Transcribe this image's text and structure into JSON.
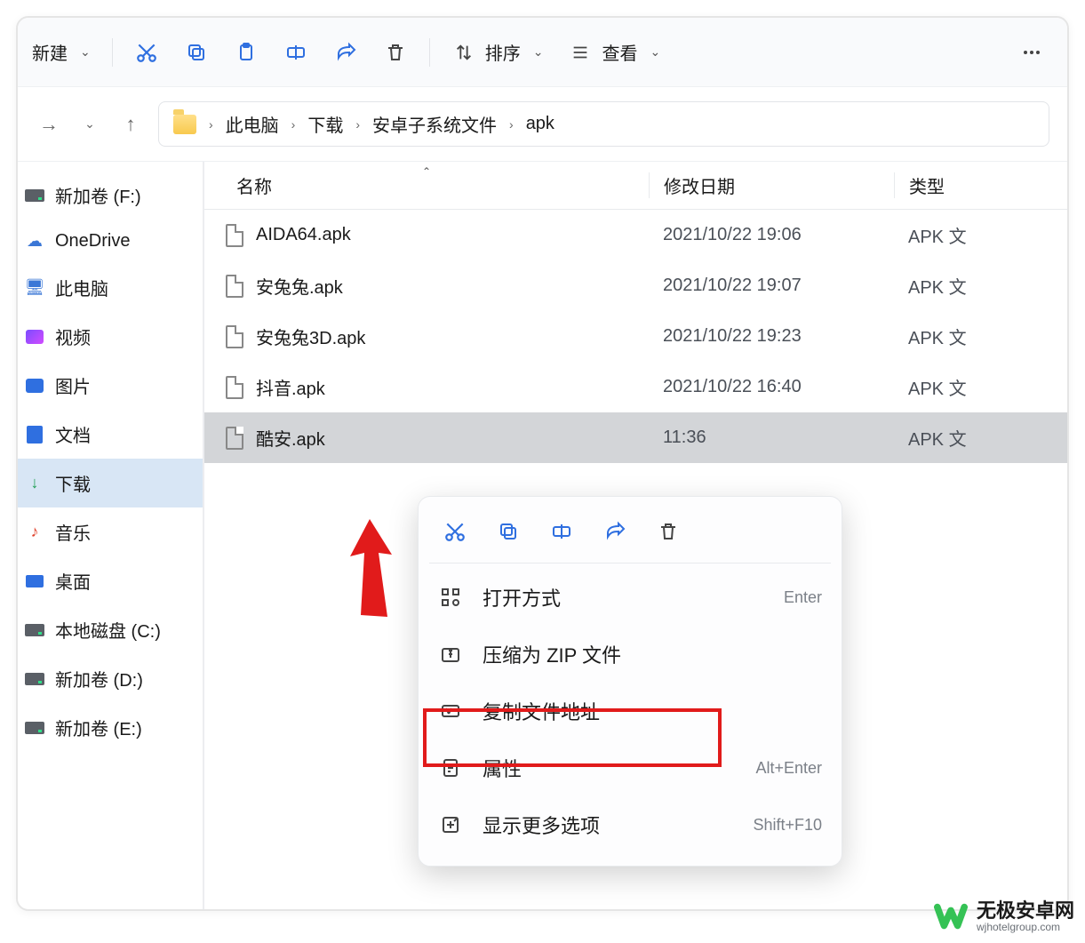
{
  "toolbar": {
    "new_label": "新建",
    "sort_label": "排序",
    "view_label": "查看"
  },
  "breadcrumb": [
    "此电脑",
    "下载",
    "安卓子系统文件",
    "apk"
  ],
  "sidebar": {
    "items": [
      {
        "label": "新加卷 (F:)",
        "icon": "drive"
      },
      {
        "label": "OneDrive",
        "icon": "cloud"
      },
      {
        "label": "此电脑",
        "icon": "pc"
      },
      {
        "label": "视频",
        "icon": "video"
      },
      {
        "label": "图片",
        "icon": "picture"
      },
      {
        "label": "文档",
        "icon": "doc"
      },
      {
        "label": "下载",
        "icon": "download",
        "active": true
      },
      {
        "label": "音乐",
        "icon": "music"
      },
      {
        "label": "桌面",
        "icon": "desktop"
      },
      {
        "label": "本地磁盘 (C:)",
        "icon": "drive"
      },
      {
        "label": "新加卷 (D:)",
        "icon": "drive"
      },
      {
        "label": "新加卷 (E:)",
        "icon": "drive"
      }
    ]
  },
  "columns": {
    "name": "名称",
    "date": "修改日期",
    "type": "类型"
  },
  "files": [
    {
      "name": "AIDA64.apk",
      "date": "2021/10/22 19:06",
      "type": "APK 文"
    },
    {
      "name": "安兔兔.apk",
      "date": "2021/10/22 19:07",
      "type": "APK 文"
    },
    {
      "name": "安兔兔3D.apk",
      "date": "2021/10/22 19:23",
      "type": "APK 文"
    },
    {
      "name": "抖音.apk",
      "date": "2021/10/22 16:40",
      "type": "APK 文"
    },
    {
      "name": "酷安.apk",
      "date": "11:36",
      "type": "APK 文",
      "selected": true
    }
  ],
  "context_menu": {
    "items": [
      {
        "label": "打开方式",
        "shortcut": "Enter",
        "icon": "openwith"
      },
      {
        "label": "压缩为 ZIP 文件",
        "shortcut": "",
        "icon": "zip"
      },
      {
        "label": "复制文件地址",
        "shortcut": "",
        "icon": "path",
        "highlighted": true
      },
      {
        "label": "属性",
        "shortcut": "Alt+Enter",
        "icon": "props"
      },
      {
        "label": "显示更多选项",
        "shortcut": "Shift+F10",
        "icon": "more"
      }
    ]
  },
  "watermark": {
    "title": "无极安卓网",
    "sub": "wjhotelgroup.com"
  }
}
